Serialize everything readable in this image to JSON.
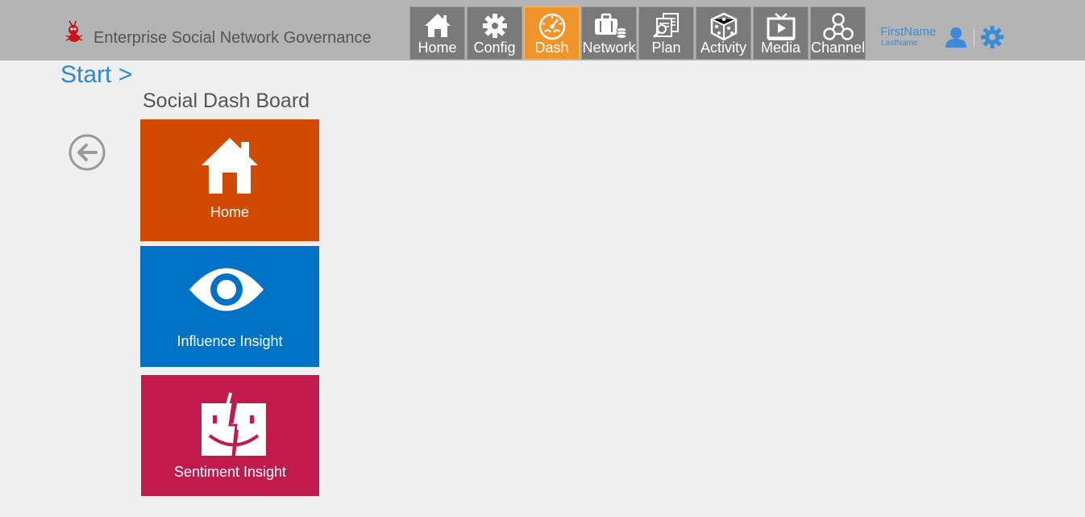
{
  "header": {
    "app_title": "Enterprise Social Network Governance",
    "logo_icon": "ant-logo-icon",
    "background": "#b4b4b4"
  },
  "nav": {
    "items": [
      {
        "label": "Home",
        "icon": "house-icon",
        "active": false
      },
      {
        "label": "Config",
        "icon": "gear-icon",
        "active": false
      },
      {
        "label": "Dash",
        "icon": "dashboard-gauge-icon",
        "active": true
      },
      {
        "label": "Network",
        "icon": "briefcase-coins-icon",
        "active": false
      },
      {
        "label": "Plan",
        "icon": "documents-search-icon",
        "active": false
      },
      {
        "label": "Activity",
        "icon": "dice-icon",
        "active": false
      },
      {
        "label": "Media",
        "icon": "tv-play-icon",
        "active": false
      },
      {
        "label": "Channel",
        "icon": "network-nodes-icon",
        "active": false
      }
    ],
    "active_color": "#f0952a",
    "inactive_color": "#7a7a7a"
  },
  "user": {
    "first_name": "FirstName",
    "last_name": "LastName",
    "user_icon": "person-icon",
    "settings_icon": "gear-icon"
  },
  "breadcrumb": {
    "label": "Start >"
  },
  "board": {
    "title": "Social Dash Board",
    "back_icon": "circle-arrow-left-icon",
    "tiles": [
      {
        "label": "Home",
        "icon": "house-icon",
        "color": "#d04a02"
      },
      {
        "label": "Influence Insight",
        "icon": "eye-icon",
        "color": "#0072c6"
      },
      {
        "label": "Sentiment Insight",
        "icon": "finder-face-icon",
        "color": "#c11a4c"
      }
    ]
  }
}
